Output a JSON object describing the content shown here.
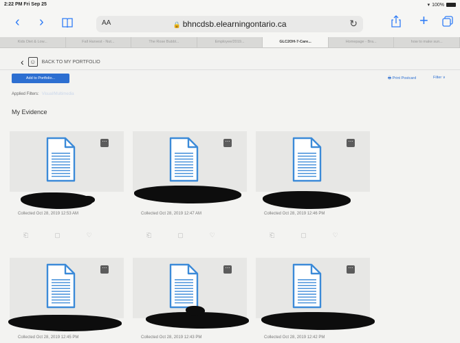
{
  "status_bar": {
    "time": "2:22 PM  Fri Sep 25",
    "battery": "100%"
  },
  "toolbar": {
    "aa_label": "AA",
    "url": "bhncdsb.elearningontario.ca"
  },
  "tabs": [
    "Kids Diet & Low...",
    "Fall Harvest - Nut...",
    "The Rose Bubbl...",
    "Employee/2019...",
    "GLC2OH-7-Care...",
    "Homepage - Bra...",
    "how to make sun..."
  ],
  "portfolio": {
    "back_label": "BACK TO MY PORTFOLIO",
    "add_button": "Add to Portfolio...",
    "print_label": "Print Postcard",
    "filter_label": "Filter",
    "applied_filters_label": "Applied Filters:",
    "applied_filters_value": "Visual/Multimedia",
    "heading": "My Evidence"
  },
  "cards": [
    {
      "collected": "Collected Oct 28, 2019 12:53 AM"
    },
    {
      "collected": "Collected Oct 28, 2019 12:47 AM"
    },
    {
      "collected": "Collected Oct 28, 2019 12:46 PM"
    },
    {
      "collected": "Collected Oct 28, 2019 12:45 PM"
    },
    {
      "collected": "Collected Oct 28, 2019 12:43 PM"
    },
    {
      "collected": "Collected Oct 28, 2019 12:42 PM"
    }
  ],
  "colors": {
    "accent": "#2f7cf6",
    "button": "#2d6fd1",
    "doc_icon": "#3b8ad8"
  }
}
